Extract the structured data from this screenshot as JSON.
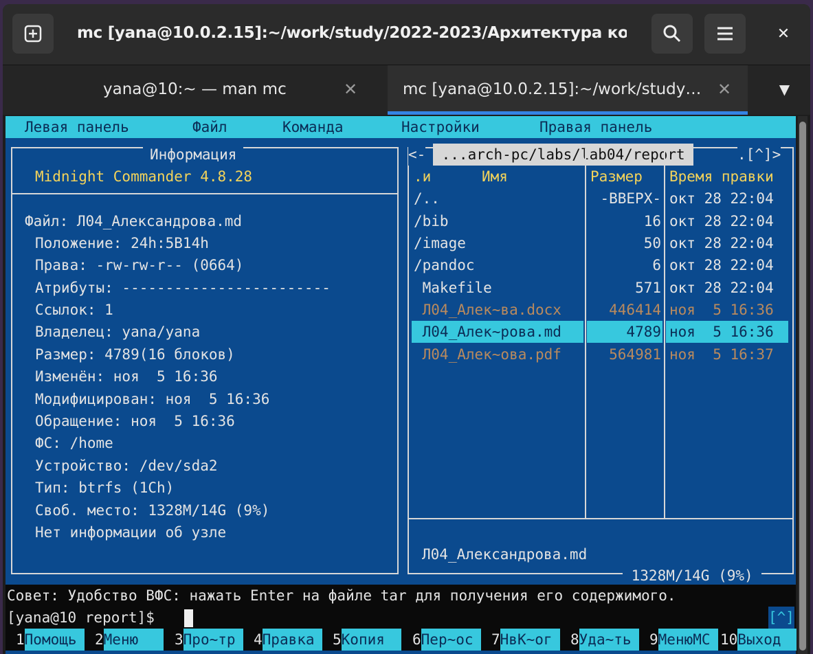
{
  "window": {
    "title": "mc [yana@10.0.2.15]:~/work/study/2022-2023/Архитектура ко…",
    "new_tab_icon": "new-tab-icon",
    "search_icon": "search-icon",
    "menu_icon": "hamburger-icon",
    "close_icon": "close-icon",
    "close_glyph": "✕"
  },
  "tabs": [
    {
      "label": "yana@10:~ — man mc",
      "close": "✕",
      "active": false
    },
    {
      "label": "mc [yana@10.0.2.15]:~/work/study…",
      "close": "✕",
      "active": true
    }
  ],
  "tabs_dropdown_glyph": "▼",
  "mc": {
    "menu": [
      "Левая панель",
      "Файл",
      "Команда",
      "Настройки",
      "Правая панель"
    ],
    "left_panel": {
      "title": "Информация",
      "version": "Midnight Commander 4.8.28",
      "file_line": "Файл: Л04_Александрова.md",
      "info": [
        "Положение: 24h:5B14h",
        "Права: -rw-rw-r-- (0664)",
        "Атрибуты: ------------------------",
        "Ссылок: 1",
        "Владелец: yana/yana",
        "Размер: 4789(16 блоков)",
        "Изменён: ноя  5 16:36",
        "Модифицирован: ноя  5 16:36",
        "Обращение: ноя  5 16:36",
        "ФС: /home",
        "Устройство: /dev/sda2",
        "Тип: btrfs (1Ch)",
        "Своб. место: 1328M/14G (9%)",
        "Нет информации об узле"
      ]
    },
    "right_panel": {
      "corner_left": "<-",
      "path": " ...arch-pc/labs/lab04/report ",
      "corner_right": ".[^]>",
      "headers": {
        "sort": ".и",
        "name": "Имя",
        "size": "Размер",
        "mtime": "Время правки"
      },
      "files": [
        {
          "name": "/..",
          "size": "-ВВЕРХ-",
          "mtime": "окт 28 22:04",
          "type": "dir"
        },
        {
          "name": "/bib",
          "size": "16",
          "mtime": "окт 28 22:04",
          "type": "dir"
        },
        {
          "name": "/image",
          "size": "50",
          "mtime": "окт 28 22:04",
          "type": "dir"
        },
        {
          "name": "/pandoc",
          "size": "6",
          "mtime": "окт 28 22:04",
          "type": "dir"
        },
        {
          "name": " Makefile",
          "size": "571",
          "mtime": "окт 28 22:04",
          "type": "file"
        },
        {
          "name": " Л04_Алек~ва.docx",
          "size": "446414",
          "mtime": "ноя  5 16:36",
          "type": "doc"
        },
        {
          "name": " Л04_Алек~рова.md",
          "size": "4789",
          "mtime": "ноя  5 16:36",
          "type": "selected"
        },
        {
          "name": " Л04_Алек~ова.pdf",
          "size": "564981",
          "mtime": "ноя  5 16:37",
          "type": "doc"
        }
      ],
      "status_file": "Л04_Александрова.md",
      "free_space": " 1328M/14G (9%) "
    },
    "hint": "Совет: Удобство ВФС: нажать Enter на файле tar для получения его содержимого.",
    "prompt": "[yana@10 report]$ ",
    "prompt_indicator": "[^]",
    "fkeys": [
      {
        "num": "1",
        "label": "Помощь"
      },
      {
        "num": "2",
        "label": "Меню"
      },
      {
        "num": "3",
        "label": "Про~тр"
      },
      {
        "num": "4",
        "label": "Правка"
      },
      {
        "num": "5",
        "label": "Копия"
      },
      {
        "num": "6",
        "label": "Пер~ос"
      },
      {
        "num": "7",
        "label": "НвК~ог"
      },
      {
        "num": "8",
        "label": "Уда~ть"
      },
      {
        "num": "9",
        "label": "МенюMC"
      },
      {
        "num": "10",
        "label": "Выход"
      }
    ]
  },
  "colors": {
    "panel_bg": "#0b4a8e",
    "highlight": "#37c8de",
    "yellow_text": "#f3d35a",
    "dim_file": "#b98a5e",
    "tab_accent": "#3584e4"
  }
}
